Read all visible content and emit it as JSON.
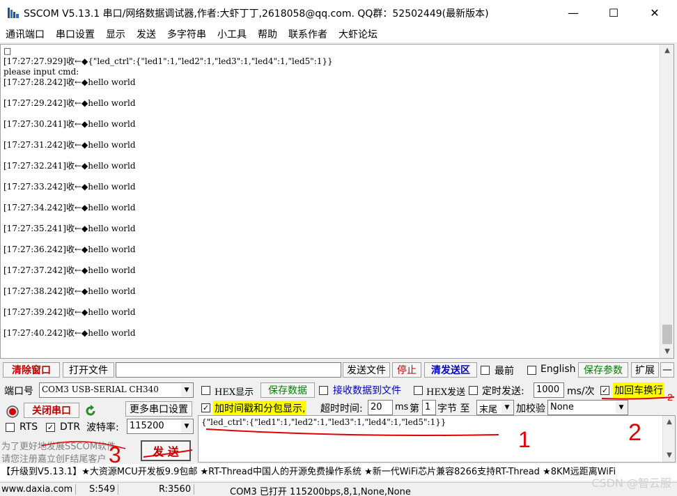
{
  "window": {
    "title": "SSCOM V5.13.1 串口/网络数据调试器,作者:大虾丁丁,2618058@qq.com. QQ群：52502449(最新版本)",
    "minimize": "—",
    "maximize": "☐",
    "close": "✕"
  },
  "menu": [
    "通讯端口",
    "串口设置",
    "显示",
    "发送",
    "多字符串",
    "小工具",
    "帮助",
    "联系作者",
    "大虾论坛"
  ],
  "receive": {
    "lines": [
      "□",
      "[17:27:27.929]收←◆{\"led_ctrl\":{\"led1\":1,\"led2\":1,\"led3\":1,\"led4\":1,\"led5\":1}}",
      "please input cmd:",
      "[17:27:28.242]收←◆hello world",
      "",
      "[17:27:29.242]收←◆hello world",
      "",
      "[17:27:30.241]收←◆hello world",
      "",
      "[17:27:31.242]收←◆hello world",
      "",
      "[17:27:32.241]收←◆hello world",
      "",
      "[17:27:33.242]收←◆hello world",
      "",
      "[17:27:34.242]收←◆hello world",
      "",
      "[17:27:35.241]收←◆hello world",
      "",
      "[17:27:36.242]收←◆hello world",
      "",
      "[17:27:37.242]收←◆hello world",
      "",
      "[17:27:38.242]收←◆hello world",
      "",
      "[17:27:39.242]收←◆hello world",
      "",
      "[17:27:40.242]收←◆hello world"
    ]
  },
  "toolbar": {
    "clear_window": "清除窗口",
    "open_file": "打开文件",
    "send_file": "发送文件",
    "stop": "停止",
    "clear_send": "清发送区",
    "topmost": "最前",
    "english": "English",
    "save_params": "保存参数",
    "expand": "扩展",
    "collapse": "—"
  },
  "port": {
    "port_label": "端口号",
    "port_value": "COM3 USB-SERIAL CH340",
    "close_port": "关闭串口",
    "more_settings": "更多串口设置",
    "rts": "RTS",
    "dtr": "DTR",
    "baud_label": "波特率:",
    "baud_value": "115200",
    "promo_line1": "为了更好地发展SSCOM软件",
    "promo_line2": "请您注册嘉立创F结尾客户",
    "send_button": "发  送"
  },
  "options": {
    "hex_display": "HEX显示",
    "save_data": "保存数据",
    "recv_to_file": "接收数据到文件",
    "hex_send": "HEX发送",
    "timed_send": "定时发送:",
    "interval": "1000",
    "interval_unit": "ms/次",
    "add_crlf": "加回车换行",
    "add_timestamp": "加时间戳和分包显示,",
    "timeout_label": "超时时间:",
    "timeout_value": "20",
    "timeout_unit": "ms",
    "byte_prefix": "第",
    "byte_value": "1",
    "byte_label": "字节 至",
    "byte_end": "末尾",
    "checksum_label": "加校验",
    "checksum_value": "None"
  },
  "send_text": "{\"led_ctrl\":{\"led1\":1,\"led2\":1,\"led3\":1,\"led4\":1,\"led5\":1}}",
  "ticker": "【升级到V5.13.1】★大资源MCU开发板9.9包邮 ★RT-Thread中国人的开源免费操作系统 ★新一代WiFi芯片兼容8266支持RT-Thread ★8KM远距离WiFi",
  "status": {
    "site": "www.daxia.com",
    "sent": "S:549",
    "received": "R:3560",
    "port_state": "COM3 已打开  115200bps,8,1,None,None"
  },
  "watermark": "CSDN @智云服",
  "annotations": [
    "1",
    "2",
    "2",
    "3"
  ],
  "colors": {
    "highlight": "#ffff00",
    "annotation_red": "#e00000"
  }
}
